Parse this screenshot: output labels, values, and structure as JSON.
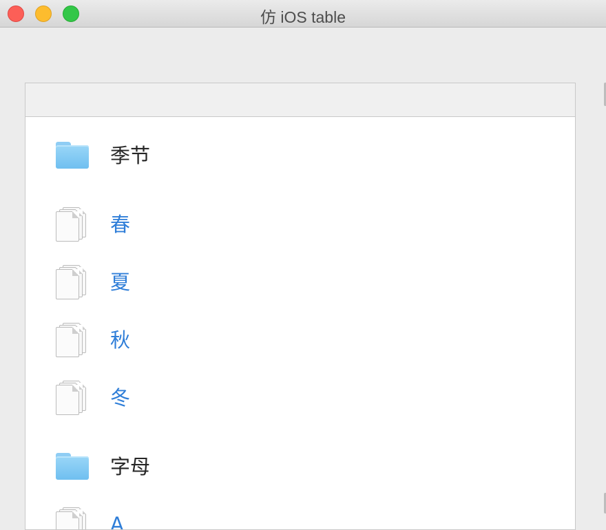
{
  "window": {
    "title": "仿 iOS table"
  },
  "table": {
    "rows": [
      {
        "type": "group",
        "label": "季节",
        "icon": "folder-icon"
      },
      {
        "type": "item",
        "label": "春",
        "icon": "documents-icon"
      },
      {
        "type": "item",
        "label": "夏",
        "icon": "documents-icon"
      },
      {
        "type": "item",
        "label": "秋",
        "icon": "documents-icon"
      },
      {
        "type": "item",
        "label": "冬",
        "icon": "documents-icon"
      },
      {
        "type": "group",
        "label": "字母",
        "icon": "folder-icon"
      },
      {
        "type": "item",
        "label": "A",
        "icon": "documents-icon"
      }
    ]
  },
  "colors": {
    "item_text": "#2f7ed8",
    "group_text": "#262626",
    "folder": "#8fcdf4"
  }
}
